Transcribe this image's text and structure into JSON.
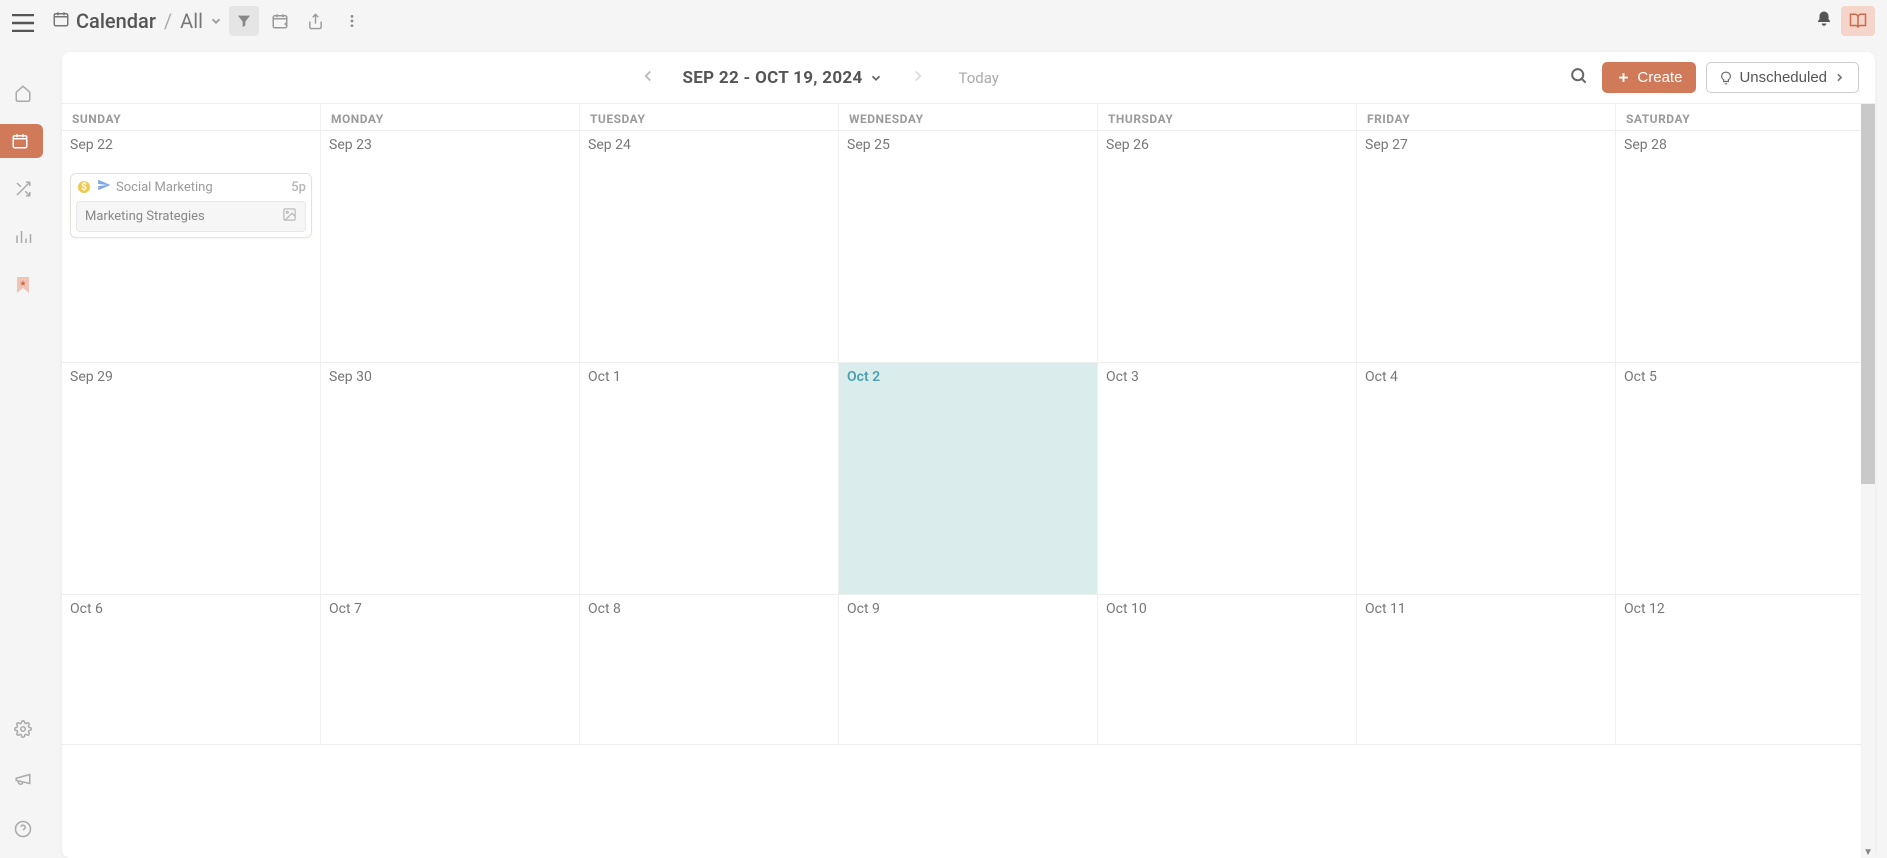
{
  "topbar": {
    "title": "Calendar",
    "separator": "/",
    "filter": "All"
  },
  "panel": {
    "date_range": "SEP 22 - OCT 19, 2024",
    "today": "Today",
    "create": "Create",
    "unscheduled": "Unscheduled"
  },
  "weekdays": [
    "SUNDAY",
    "MONDAY",
    "TUESDAY",
    "WEDNESDAY",
    "THURSDAY",
    "FRIDAY",
    "SATURDAY"
  ],
  "weeks": [
    {
      "days": [
        {
          "label": "Sep 22",
          "today": false,
          "events": [
            {
              "title": "Social Marketing",
              "time": "5p",
              "body": "Marketing Strategies"
            }
          ]
        },
        {
          "label": "Sep 23",
          "today": false,
          "events": []
        },
        {
          "label": "Sep 24",
          "today": false,
          "events": []
        },
        {
          "label": "Sep 25",
          "today": false,
          "events": []
        },
        {
          "label": "Sep 26",
          "today": false,
          "events": []
        },
        {
          "label": "Sep 27",
          "today": false,
          "events": []
        },
        {
          "label": "Sep 28",
          "today": false,
          "events": []
        }
      ]
    },
    {
      "days": [
        {
          "label": "Sep 29",
          "today": false,
          "events": []
        },
        {
          "label": "Sep 30",
          "today": false,
          "events": []
        },
        {
          "label": "Oct 1",
          "today": false,
          "events": []
        },
        {
          "label": "Oct 2",
          "today": true,
          "events": []
        },
        {
          "label": "Oct 3",
          "today": false,
          "events": []
        },
        {
          "label": "Oct 4",
          "today": false,
          "events": []
        },
        {
          "label": "Oct 5",
          "today": false,
          "events": []
        }
      ]
    },
    {
      "days": [
        {
          "label": "Oct 6",
          "today": false,
          "events": []
        },
        {
          "label": "Oct 7",
          "today": false,
          "events": []
        },
        {
          "label": "Oct 8",
          "today": false,
          "events": []
        },
        {
          "label": "Oct 9",
          "today": false,
          "events": []
        },
        {
          "label": "Oct 10",
          "today": false,
          "events": []
        },
        {
          "label": "Oct 11",
          "today": false,
          "events": []
        },
        {
          "label": "Oct 12",
          "today": false,
          "events": []
        }
      ]
    }
  ]
}
